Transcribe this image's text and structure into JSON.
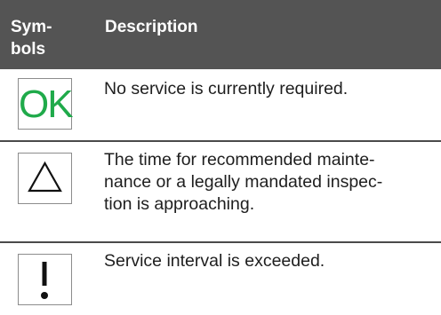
{
  "header": {
    "symbols_label": "Sym-\nbols",
    "description_label": "Description"
  },
  "rows": [
    {
      "symbol_text": "OK",
      "symbol_color": "#1faa4a",
      "icon": "ok-icon",
      "description": "No service is currently required."
    },
    {
      "icon": "triangle-warning-icon",
      "description": "The time for recommended maintenance or a legally mandated inspection is approaching.",
      "description_lines": [
        "The time for recommended mainte-",
        "nance or a legally mandated inspec-",
        "tion is approaching."
      ]
    },
    {
      "icon": "exclamation-icon",
      "description": "Service interval is exceeded."
    }
  ]
}
